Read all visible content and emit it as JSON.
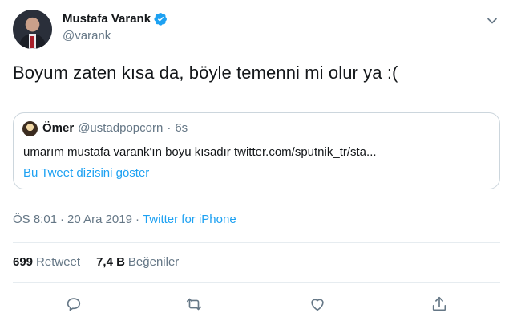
{
  "author": {
    "name": "Mustafa Varank",
    "handle": "@varank"
  },
  "tweet": {
    "text": "Boyum zaten kısa da, böyle temenni mi olur ya :("
  },
  "quoted": {
    "name": "Ömer",
    "handle": "@ustadpopcorn",
    "separator": "·",
    "time": "6s",
    "text": "umarım mustafa varank'ın boyu kısadır twitter.com/sputnik_tr/sta...",
    "show_thread": "Bu Tweet dizisini göster"
  },
  "meta": {
    "time": "ÖS 8:01",
    "sep1": "·",
    "date": "20 Ara 2019",
    "sep2": "·",
    "source": "Twitter for iPhone"
  },
  "stats": {
    "retweets": "699",
    "retweets_label": "Retweet",
    "likes": "7,4 B",
    "likes_label": "Beğeniler"
  },
  "icons": {
    "verified": "verified-badge-icon",
    "more": "chevron-down-icon",
    "reply": "reply-icon",
    "retweet": "retweet-icon",
    "like": "heart-icon",
    "share": "share-icon"
  },
  "colors": {
    "accent": "#1da1f2",
    "text": "#14171a",
    "muted": "#657786",
    "border": "#ccd6dd"
  }
}
